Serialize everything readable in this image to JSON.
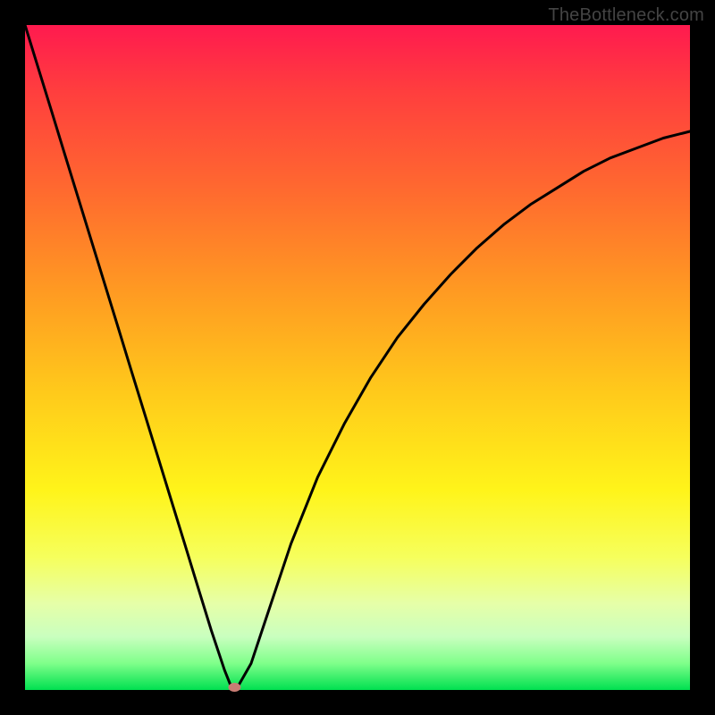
{
  "watermark": "TheBottleneck.com",
  "chart_data": {
    "type": "line",
    "title": "",
    "xlabel": "",
    "ylabel": "",
    "xlim": [
      0,
      1
    ],
    "ylim": [
      0,
      1
    ],
    "x": [
      0.0,
      0.02,
      0.04,
      0.06,
      0.08,
      0.1,
      0.12,
      0.14,
      0.16,
      0.18,
      0.2,
      0.22,
      0.24,
      0.26,
      0.28,
      0.3,
      0.31,
      0.315,
      0.32,
      0.34,
      0.36,
      0.4,
      0.44,
      0.48,
      0.52,
      0.56,
      0.6,
      0.64,
      0.68,
      0.72,
      0.76,
      0.8,
      0.84,
      0.88,
      0.92,
      0.96,
      1.0
    ],
    "y": [
      1.0,
      0.935,
      0.87,
      0.805,
      0.74,
      0.675,
      0.61,
      0.545,
      0.48,
      0.415,
      0.35,
      0.285,
      0.22,
      0.155,
      0.09,
      0.03,
      0.005,
      0.0,
      0.005,
      0.04,
      0.1,
      0.22,
      0.32,
      0.4,
      0.47,
      0.53,
      0.58,
      0.625,
      0.665,
      0.7,
      0.73,
      0.755,
      0.78,
      0.8,
      0.815,
      0.83,
      0.84
    ],
    "min_point": {
      "x": 0.315,
      "y": 0.0
    },
    "gradient_stops": [
      {
        "pos": 0.0,
        "color": "#ff1a4f"
      },
      {
        "pos": 0.1,
        "color": "#ff3e3e"
      },
      {
        "pos": 0.25,
        "color": "#ff6a2f"
      },
      {
        "pos": 0.4,
        "color": "#ff9a22"
      },
      {
        "pos": 0.55,
        "color": "#ffc91b"
      },
      {
        "pos": 0.7,
        "color": "#fff41a"
      },
      {
        "pos": 0.8,
        "color": "#f6ff5c"
      },
      {
        "pos": 0.87,
        "color": "#e6ffa8"
      },
      {
        "pos": 0.92,
        "color": "#c9ffbf"
      },
      {
        "pos": 0.96,
        "color": "#7fff8a"
      },
      {
        "pos": 1.0,
        "color": "#00e050"
      }
    ]
  }
}
